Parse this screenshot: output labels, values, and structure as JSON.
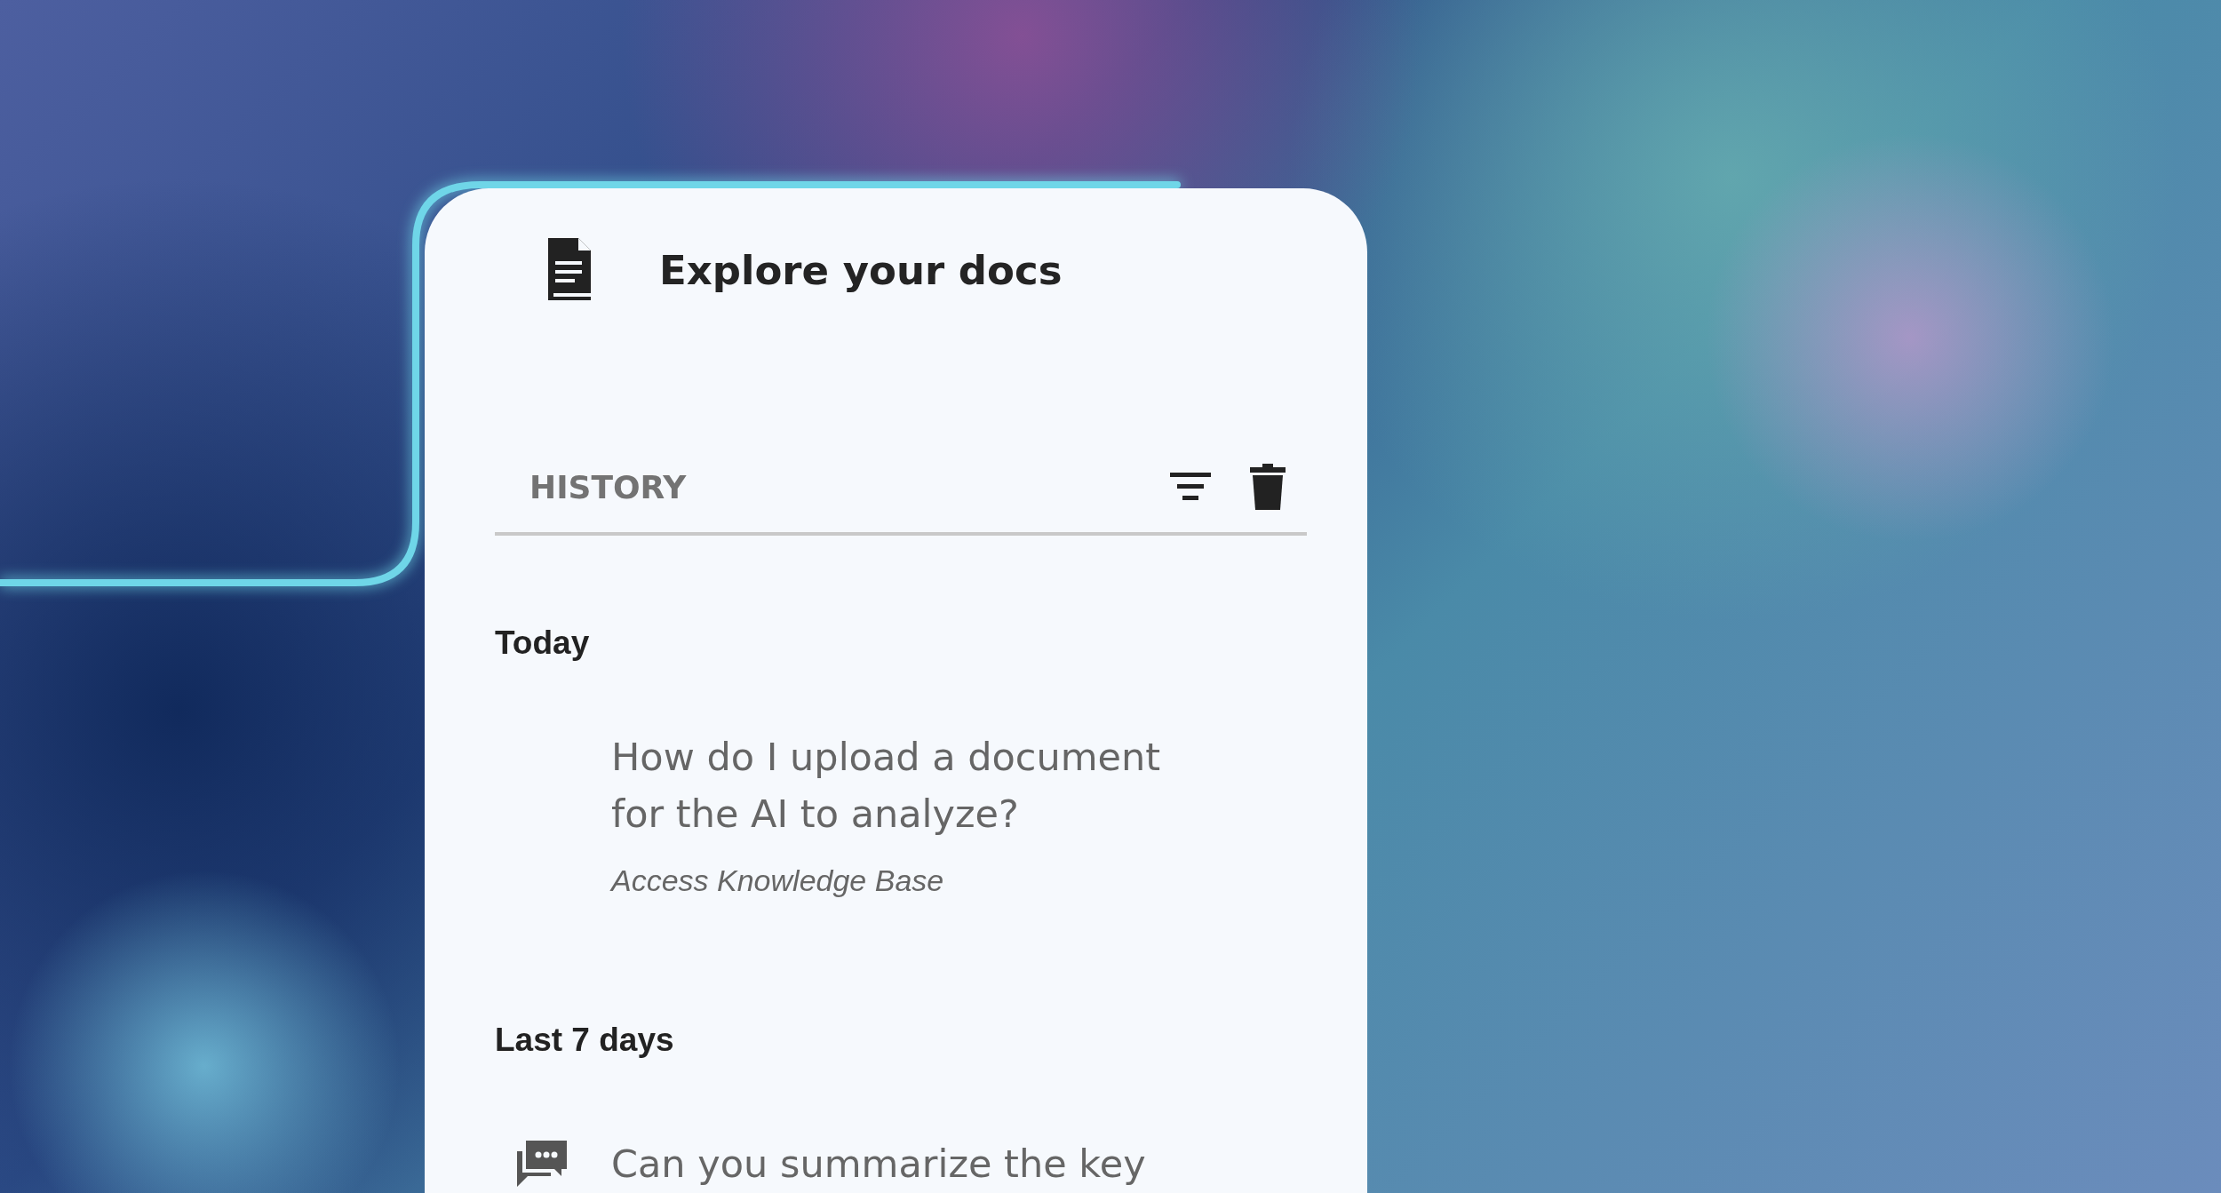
{
  "panel": {
    "title": "Explore your docs"
  },
  "history": {
    "heading": "HISTORY"
  },
  "groups": [
    {
      "label": "Today",
      "items": [
        {
          "question": "How do I upload a document for the AI to analyze?",
          "source": "Access Knowledge Base",
          "icon": false
        }
      ]
    },
    {
      "label": "Last 7 days",
      "items": [
        {
          "question": "Can you summarize the key",
          "icon": true
        }
      ]
    }
  ]
}
